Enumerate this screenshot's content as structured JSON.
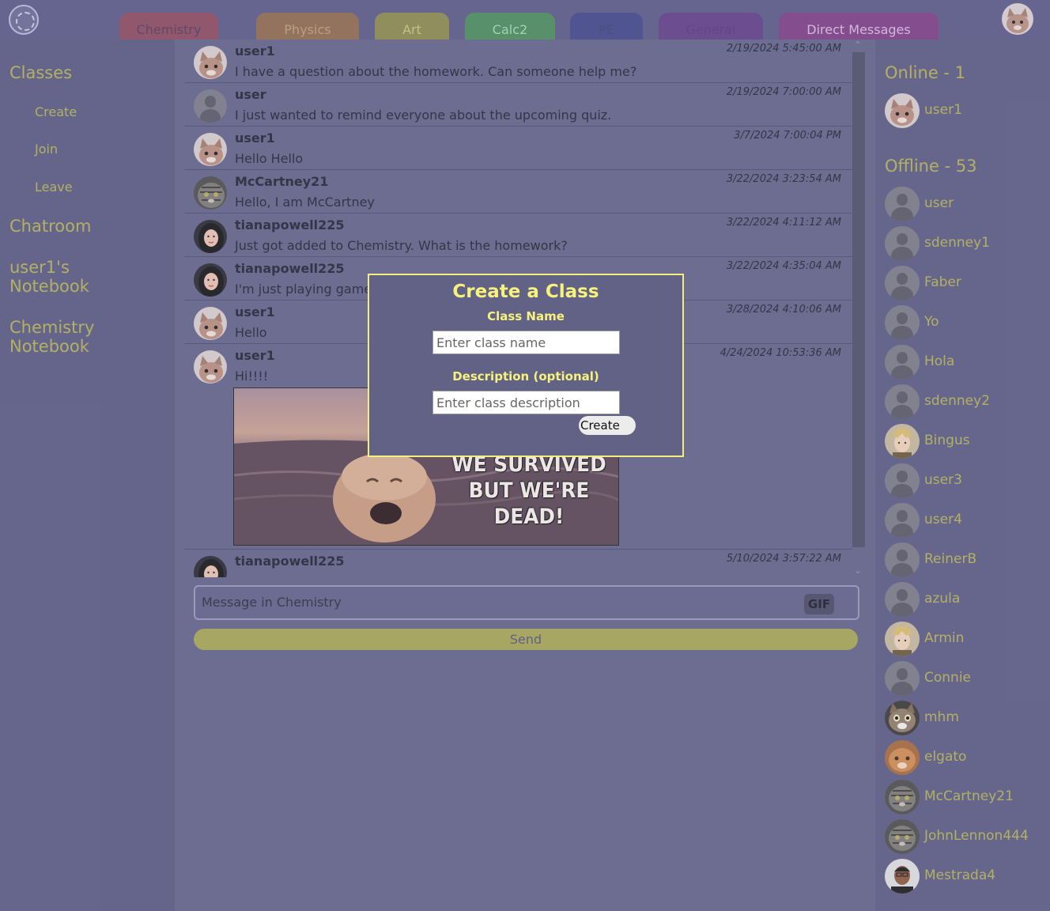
{
  "tabs": [
    {
      "label": "Chemistry",
      "color": "#8d4b5e",
      "text": "#563b56"
    },
    {
      "label": "Physics",
      "color": "#8f6a4d",
      "text": "#b89e78"
    },
    {
      "label": "Art",
      "color": "#8a894a",
      "text": "#c7c27c"
    },
    {
      "label": "Calc2",
      "color": "#4b8b5a",
      "text": "#a1d6b3"
    },
    {
      "label": "PE",
      "color": "#434787",
      "text": "#3e4277"
    },
    {
      "label": "General",
      "color": "#623f84",
      "text": "#55397a"
    },
    {
      "label": "Direct Messages",
      "color": "#7d3f83",
      "text": "#d6b9dd"
    }
  ],
  "sidebar": {
    "classes": "Classes",
    "items": [
      "Create",
      "Join",
      "Leave"
    ],
    "chatroom": "Chatroom",
    "notebook": "user1's Notebook",
    "class_notebook": "Chemistry Notebook"
  },
  "messages": [
    {
      "user": "user1",
      "time": "2/19/2024 5:45:00 AM",
      "text": "I have a question about the homework. Can someone help me?",
      "avatar": "cat"
    },
    {
      "user": "user",
      "time": "2/19/2024 7:00:00 AM",
      "text": "I just wanted to remind everyone about the upcoming quiz.",
      "avatar": "default"
    },
    {
      "user": "user1",
      "time": "3/7/2024 7:00:04 PM",
      "text": "Hello Hello",
      "avatar": "cat"
    },
    {
      "user": "McCartney21",
      "time": "3/22/2024 3:23:54 AM",
      "text": "Hello, I am McCartney",
      "avatar": "tabby"
    },
    {
      "user": "tianapowell225",
      "time": "3/22/2024 4:11:12 AM",
      "text": "Just got added to Chemistry. What is the homework?",
      "avatar": "woman"
    },
    {
      "user": "tianapowell225",
      "time": "3/22/2024 4:35:04 AM",
      "text": "I'm just playing game",
      "avatar": "woman"
    },
    {
      "user": "user1",
      "time": "3/28/2024 4:10:06 AM",
      "text": "Hello",
      "avatar": "cat"
    },
    {
      "user": "user1",
      "time": "4/24/2024 10:53:36 AM",
      "text": "Hi!!!!",
      "avatar": "cat"
    },
    {
      "user": "tianapowell225",
      "time": "5/10/2024 3:57:22 AM",
      "text": "",
      "avatar": "woman"
    }
  ],
  "meme_text": "WE SURVIVED BUT WE'RE DEAD!",
  "composer": {
    "placeholder": "Message in Chemistry",
    "gif": "GIF",
    "send": "Send"
  },
  "online": {
    "header": "Online - 1",
    "members": [
      {
        "name": "user1",
        "avatar": "cat"
      }
    ]
  },
  "offline": {
    "header": "Offline - 53",
    "members": [
      {
        "name": "user",
        "avatar": "default"
      },
      {
        "name": "sdenney1",
        "avatar": "default"
      },
      {
        "name": "Faber",
        "avatar": "default"
      },
      {
        "name": "Yo",
        "avatar": "default"
      },
      {
        "name": "Hola",
        "avatar": "default"
      },
      {
        "name": "sdenney2",
        "avatar": "default"
      },
      {
        "name": "Bingus",
        "avatar": "blond"
      },
      {
        "name": "user3",
        "avatar": "default"
      },
      {
        "name": "user4",
        "avatar": "default"
      },
      {
        "name": "ReinerB",
        "avatar": "default"
      },
      {
        "name": "azula",
        "avatar": "default"
      },
      {
        "name": "Armin",
        "avatar": "blond"
      },
      {
        "name": "Connie",
        "avatar": "default"
      },
      {
        "name": "mhm",
        "avatar": "catface"
      },
      {
        "name": "elgato",
        "avatar": "orange"
      },
      {
        "name": "McCartney21",
        "avatar": "tabby"
      },
      {
        "name": "JohnLennon444",
        "avatar": "tabby"
      },
      {
        "name": "Mestrada4",
        "avatar": "man"
      }
    ]
  },
  "modal": {
    "title": "Create a Class",
    "name_label": "Class Name",
    "name_placeholder": "Enter class name",
    "desc_label": "Description (optional)",
    "desc_placeholder": "Enter class description",
    "create": "Create"
  }
}
